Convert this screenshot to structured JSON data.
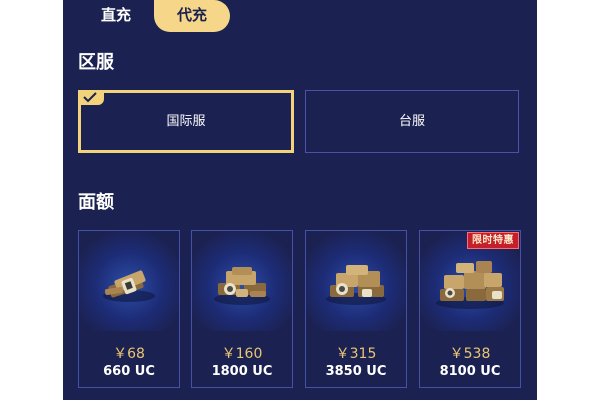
{
  "tabs": [
    {
      "label": "直充"
    },
    {
      "label": "代充"
    }
  ],
  "region": {
    "title": "区服",
    "options": [
      {
        "label": "国际服",
        "selected": true
      },
      {
        "label": "台服",
        "selected": false
      }
    ]
  },
  "amount": {
    "title": "面额",
    "cards": [
      {
        "price": "￥68",
        "uc": "660 UC"
      },
      {
        "price": "￥160",
        "uc": "1800 UC"
      },
      {
        "price": "￥315",
        "uc": "3850 UC"
      },
      {
        "price": "￥538",
        "uc": "8100 UC",
        "badge": "限时特惠"
      }
    ]
  },
  "colors": {
    "panel_bg": "#1b2150",
    "accent": "#f3d27c",
    "price": "#e9c674",
    "badge": "#c41f2a"
  }
}
